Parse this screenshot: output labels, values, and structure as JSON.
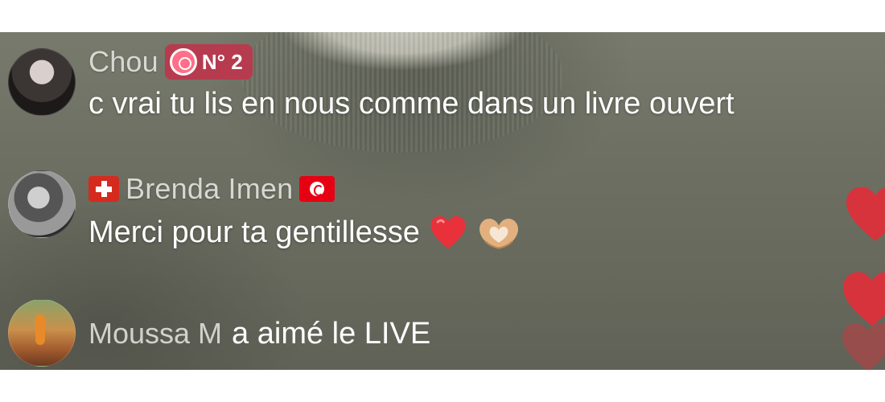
{
  "comments": [
    {
      "username": "Chou",
      "rank_badge": "N° 2",
      "text": "c vrai tu lis en nous comme dans un livre ouvert",
      "avatar_icon": "chou-avatar",
      "badge_color": "#b63b4f"
    },
    {
      "username": "Brenda Imen",
      "prefix_flag_icon": "switzerland-flag-icon",
      "suffix_flag_icon": "tunisia-flag-icon",
      "text": "Merci pour ta gentillesse",
      "emojis": [
        "red-heart-icon",
        "heart-hands-icon"
      ],
      "avatar_icon": "brenda-avatar"
    }
  ],
  "like_event": {
    "username": "Moussa M",
    "action": "a aimé le LIVE",
    "avatar_icon": "moussa-avatar"
  },
  "floating_hearts_color": "#d7333c"
}
